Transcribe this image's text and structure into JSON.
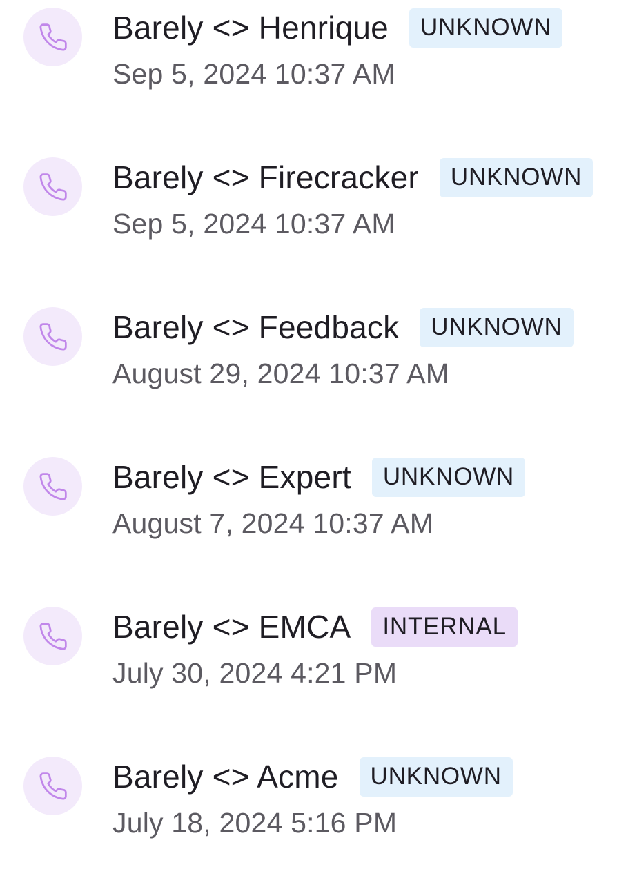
{
  "calls": [
    {
      "title": "Barely <> Henrique",
      "badge": "UNKNOWN",
      "badge_type": "unknown",
      "date": "Sep 5, 2024 10:37 AM",
      "icon": "phone-icon"
    },
    {
      "title": "Barely <> Firecracker",
      "badge": "UNKNOWN",
      "badge_type": "unknown",
      "date": "Sep 5, 2024 10:37 AM",
      "icon": "phone-icon"
    },
    {
      "title": "Barely <> Feedback",
      "badge": "UNKNOWN",
      "badge_type": "unknown",
      "date": "August 29, 2024 10:37 AM",
      "icon": "phone-icon"
    },
    {
      "title": "Barely <> Expert",
      "badge": "UNKNOWN",
      "badge_type": "unknown",
      "date": "August 7, 2024 10:37 AM",
      "icon": "phone-icon"
    },
    {
      "title": "Barely <> EMCA",
      "badge": "INTERNAL",
      "badge_type": "internal",
      "date": "July 30, 2024 4:21 PM",
      "icon": "phone-icon"
    },
    {
      "title": "Barely <> Acme",
      "badge": "UNKNOWN",
      "badge_type": "unknown",
      "date": "July 18, 2024 5:16 PM",
      "icon": "phone-icon"
    }
  ],
  "colors": {
    "icon_stroke": "#c187ea",
    "avatar_bg": "#f3eafb",
    "badge_unknown_bg": "#e3f1fc",
    "badge_internal_bg": "#eadcf8",
    "title_text": "#1f1d24",
    "date_text": "#5c5a61"
  }
}
